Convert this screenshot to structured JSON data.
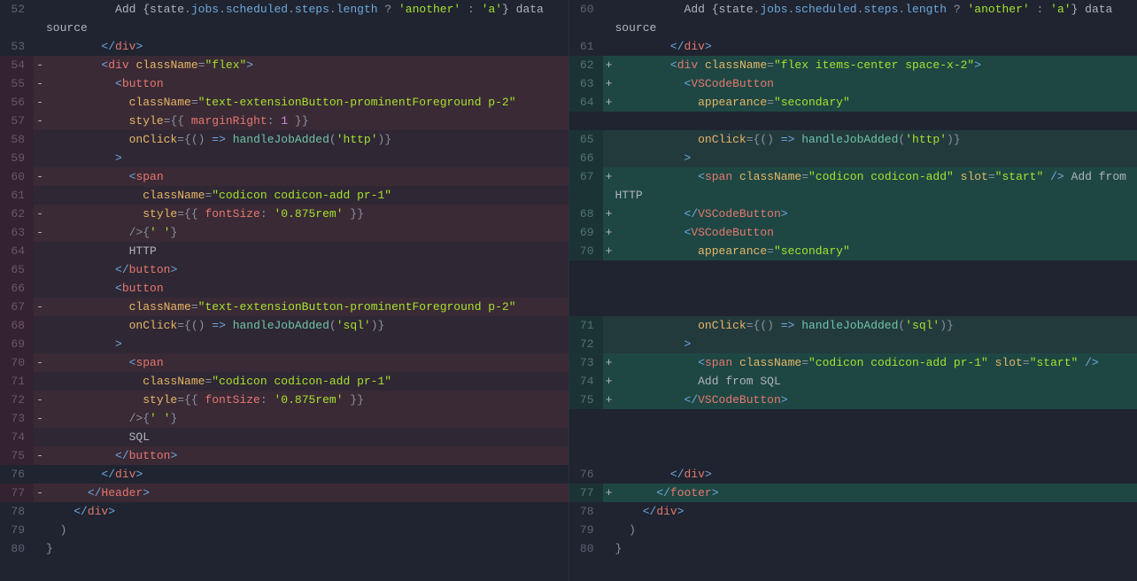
{
  "left": [
    {
      "n": 52,
      "m": "",
      "cls": "ctx",
      "wrap": true,
      "html": "          <span class='pl'>Add {state</span><span class='p'>.</span><span class='bl'>jobs</span><span class='p'>.</span><span class='bl'>scheduled</span><span class='p'>.</span><span class='bl'>steps</span><span class='p'>.</span><span class='bl'>length</span> <span class='p'>?</span> <span class='st'>'another'</span> <span class='p'>:</span> <span class='st'>'a'</span><span class='pl'>} data source</span>"
    },
    {
      "n": 53,
      "m": "",
      "cls": "ctx",
      "html": "        <span class='bl'>&lt;/</span><span class='tg'>div</span><span class='bl'>&gt;</span>"
    },
    {
      "n": 54,
      "m": "-",
      "cls": "del",
      "html": "        <span class='bl'>&lt;</span><span class='tg'>div</span> <span class='at'>className</span><span class='p'>=</span><span class='st'>\"flex\"</span><span class='bl'>&gt;</span>"
    },
    {
      "n": 55,
      "m": "-",
      "cls": "del",
      "html": "          <span class='bl'>&lt;</span><span class='tg'>button</span>"
    },
    {
      "n": 56,
      "m": "-",
      "cls": "del",
      "html": "            <span class='at'>className</span><span class='p'>=</span><span class='st'>\"text-extensionButton-prominentForeground p-2\"</span>"
    },
    {
      "n": 57,
      "m": "-",
      "cls": "del",
      "html": "            <span class='at'>style</span><span class='p'>=</span><span class='p'>{{ </span><span class='id'>marginRight</span><span class='p'>: </span><span class='nm'>1</span><span class='p'> }}</span>"
    },
    {
      "n": 58,
      "m": "",
      "cls": "dn",
      "html": "            <span class='at'>onClick</span><span class='p'>=</span><span class='p'>{() </span><span class='bl'>=&gt;</span><span class='p'> </span><span class='fn'>handleJobAdded</span><span class='p'>(</span><span class='st'>'http'</span><span class='p'>)}</span>"
    },
    {
      "n": 59,
      "m": "",
      "cls": "dn",
      "html": "          <span class='bl'>&gt;</span>"
    },
    {
      "n": 60,
      "m": "-",
      "cls": "del",
      "html": "            <span class='bl'>&lt;</span><span class='tg'>span</span>"
    },
    {
      "n": 61,
      "m": "",
      "cls": "dn",
      "html": "              <span class='at'>className</span><span class='p'>=</span><span class='st'>\"codicon codicon-add pr-1\"</span>"
    },
    {
      "n": 62,
      "m": "-",
      "cls": "del",
      "html": "              <span class='at'>style</span><span class='p'>=</span><span class='p'>{{ </span><span class='id'>fontSize</span><span class='p'>: </span><span class='st'>'0.875rem'</span><span class='p'> }}</span>"
    },
    {
      "n": 63,
      "m": "-",
      "cls": "del",
      "html": "            <span class='p'>/&gt;{</span><span class='st'>' '</span><span class='p'>}</span>"
    },
    {
      "n": 64,
      "m": "",
      "cls": "dn",
      "html": "            <span class='pl'>HTTP</span>"
    },
    {
      "n": 65,
      "m": "",
      "cls": "dn",
      "html": "          <span class='bl'>&lt;/</span><span class='tg'>button</span><span class='bl'>&gt;</span>"
    },
    {
      "n": 66,
      "m": "",
      "cls": "dn",
      "html": "          <span class='bl'>&lt;</span><span class='tg'>button</span>"
    },
    {
      "n": 67,
      "m": "-",
      "cls": "del",
      "html": "            <span class='at'>className</span><span class='p'>=</span><span class='st'>\"text-extensionButton-prominentForeground p-2\"</span>"
    },
    {
      "n": 68,
      "m": "",
      "cls": "dn",
      "html": "            <span class='at'>onClick</span><span class='p'>=</span><span class='p'>{() </span><span class='bl'>=&gt;</span><span class='p'> </span><span class='fn'>handleJobAdded</span><span class='p'>(</span><span class='st'>'sql'</span><span class='p'>)}</span>"
    },
    {
      "n": 69,
      "m": "",
      "cls": "dn",
      "html": "          <span class='bl'>&gt;</span>"
    },
    {
      "n": 70,
      "m": "-",
      "cls": "del",
      "html": "            <span class='bl'>&lt;</span><span class='tg'>span</span>"
    },
    {
      "n": 71,
      "m": "",
      "cls": "dn",
      "html": "              <span class='at'>className</span><span class='p'>=</span><span class='st'>\"codicon codicon-add pr-1\"</span>"
    },
    {
      "n": 72,
      "m": "-",
      "cls": "del",
      "html": "              <span class='at'>style</span><span class='p'>=</span><span class='p'>{{ </span><span class='id'>fontSize</span><span class='p'>: </span><span class='st'>'0.875rem'</span><span class='p'> }}</span>"
    },
    {
      "n": 73,
      "m": "-",
      "cls": "del",
      "html": "            <span class='p'>/&gt;{</span><span class='st'>' '</span><span class='p'>}</span>"
    },
    {
      "n": 74,
      "m": "",
      "cls": "dn",
      "html": "            <span class='pl'>SQL</span>"
    },
    {
      "n": 75,
      "m": "-",
      "cls": "del",
      "html": "          <span class='bl'>&lt;/</span><span class='tg'>button</span><span class='bl'>&gt;</span>"
    },
    {
      "n": 76,
      "m": "",
      "cls": "ctx",
      "html": "        <span class='bl'>&lt;/</span><span class='tg'>div</span><span class='bl'>&gt;</span>"
    },
    {
      "n": 77,
      "m": "-",
      "cls": "del",
      "html": "      <span class='bl'>&lt;/</span><span class='tg'>Header</span><span class='bl'>&gt;</span>"
    },
    {
      "n": 78,
      "m": "",
      "cls": "ctx",
      "html": "    <span class='bl'>&lt;/</span><span class='tg'>div</span><span class='bl'>&gt;</span>"
    },
    {
      "n": 79,
      "m": "",
      "cls": "ctx",
      "html": "  <span class='p'>)</span>"
    },
    {
      "n": 80,
      "m": "",
      "cls": "ctx",
      "html": "<span class='p'>}</span>"
    }
  ],
  "right": [
    {
      "n": 60,
      "m": "",
      "cls": "ctx",
      "wrap": true,
      "html": "          <span class='pl'>Add {state</span><span class='p'>.</span><span class='bl'>jobs</span><span class='p'>.</span><span class='bl'>scheduled</span><span class='p'>.</span><span class='bl'>steps</span><span class='p'>.</span><span class='bl'>length</span> <span class='p'>?</span> <span class='st'>'another'</span> <span class='p'>:</span> <span class='st'>'a'</span><span class='pl'>} data source</span>"
    },
    {
      "n": 61,
      "m": "",
      "cls": "ctx",
      "html": "        <span class='bl'>&lt;/</span><span class='tg'>div</span><span class='bl'>&gt;</span>"
    },
    {
      "n": 62,
      "m": "+",
      "cls": "ah",
      "html": "        <span class='bl'>&lt;</span><span class='tg'>div</span> <span class='at'>className</span><span class='p'>=</span><span class='st'>\"flex items-center space-x-2\"</span><span class='bl'>&gt;</span>"
    },
    {
      "n": 63,
      "m": "+",
      "cls": "ah",
      "html": "          <span class='bl'>&lt;</span><span class='tg'>VSCodeButton</span>"
    },
    {
      "n": 64,
      "m": "+",
      "cls": "ah",
      "html": "            <span class='at'>appearance</span><span class='p'>=</span><span class='st'>\"secondary\"</span>"
    },
    {
      "n": "",
      "m": "",
      "cls": "blank",
      "html": ""
    },
    {
      "n": 65,
      "m": "",
      "cls": "add",
      "html": "            <span class='at'>onClick</span><span class='p'>=</span><span class='p'>{() </span><span class='bl'>=&gt;</span><span class='p'> </span><span class='fn'>handleJobAdded</span><span class='p'>(</span><span class='st'>'http'</span><span class='p'>)}</span>"
    },
    {
      "n": 66,
      "m": "",
      "cls": "add",
      "html": "          <span class='bl'>&gt;</span>"
    },
    {
      "n": 67,
      "m": "+",
      "cls": "ah",
      "wrap": true,
      "html": "            <span class='bl'>&lt;</span><span class='tg'>span</span> <span class='at'>className</span><span class='p'>=</span><span class='st'>\"codicon codicon-add\"</span> <span class='at'>slot</span><span class='p'>=</span><span class='st'>\"start\"</span> <span class='bl'>/&gt;</span> <span class='pl'>Add from HTTP</span>"
    },
    {
      "n": 68,
      "m": "+",
      "cls": "ah",
      "html": "          <span class='bl'>&lt;/</span><span class='tg'>VSCodeButton</span><span class='bl'>&gt;</span>"
    },
    {
      "n": 69,
      "m": "+",
      "cls": "ah",
      "html": "          <span class='bl'>&lt;</span><span class='tg'>VSCodeButton</span>"
    },
    {
      "n": 70,
      "m": "+",
      "cls": "ah",
      "html": "            <span class='at'>appearance</span><span class='p'>=</span><span class='st'>\"secondary\"</span>"
    },
    {
      "n": "",
      "m": "",
      "cls": "blank",
      "html": ""
    },
    {
      "n": "",
      "m": "",
      "cls": "blank",
      "html": ""
    },
    {
      "n": "",
      "m": "",
      "cls": "blank",
      "html": ""
    },
    {
      "n": 71,
      "m": "",
      "cls": "add",
      "html": "            <span class='at'>onClick</span><span class='p'>=</span><span class='p'>{() </span><span class='bl'>=&gt;</span><span class='p'> </span><span class='fn'>handleJobAdded</span><span class='p'>(</span><span class='st'>'sql'</span><span class='p'>)}</span>"
    },
    {
      "n": 72,
      "m": "",
      "cls": "add",
      "html": "          <span class='bl'>&gt;</span>"
    },
    {
      "n": 73,
      "m": "+",
      "cls": "ah",
      "html": "            <span class='bl'>&lt;</span><span class='tg'>span</span> <span class='at'>className</span><span class='p'>=</span><span class='st'>\"codicon codicon-add pr-1\"</span> <span class='at'>slot</span><span class='p'>=</span><span class='st'>\"start\"</span> <span class='bl'>/&gt;</span>"
    },
    {
      "n": 74,
      "m": "+",
      "cls": "ah",
      "html": "            <span class='pl'>Add from SQL</span>"
    },
    {
      "n": 75,
      "m": "+",
      "cls": "ah",
      "html": "          <span class='bl'>&lt;/</span><span class='tg'>VSCodeButton</span><span class='bl'>&gt;</span>"
    },
    {
      "n": "",
      "m": "",
      "cls": "blank",
      "html": ""
    },
    {
      "n": "",
      "m": "",
      "cls": "blank",
      "html": ""
    },
    {
      "n": "",
      "m": "",
      "cls": "blank",
      "html": ""
    },
    {
      "n": 76,
      "m": "",
      "cls": "ctx",
      "html": "        <span class='bl'>&lt;/</span><span class='tg'>div</span><span class='bl'>&gt;</span>"
    },
    {
      "n": 77,
      "m": "+",
      "cls": "ah",
      "html": "      <span class='bl'>&lt;/</span><span class='tg'>footer</span><span class='bl'>&gt;</span>"
    },
    {
      "n": 78,
      "m": "",
      "cls": "ctx",
      "html": "    <span class='bl'>&lt;/</span><span class='tg'>div</span><span class='bl'>&gt;</span>"
    },
    {
      "n": 79,
      "m": "",
      "cls": "ctx",
      "html": "  <span class='p'>)</span>"
    },
    {
      "n": 80,
      "m": "",
      "cls": "ctx",
      "html": "<span class='p'>}</span>"
    }
  ]
}
